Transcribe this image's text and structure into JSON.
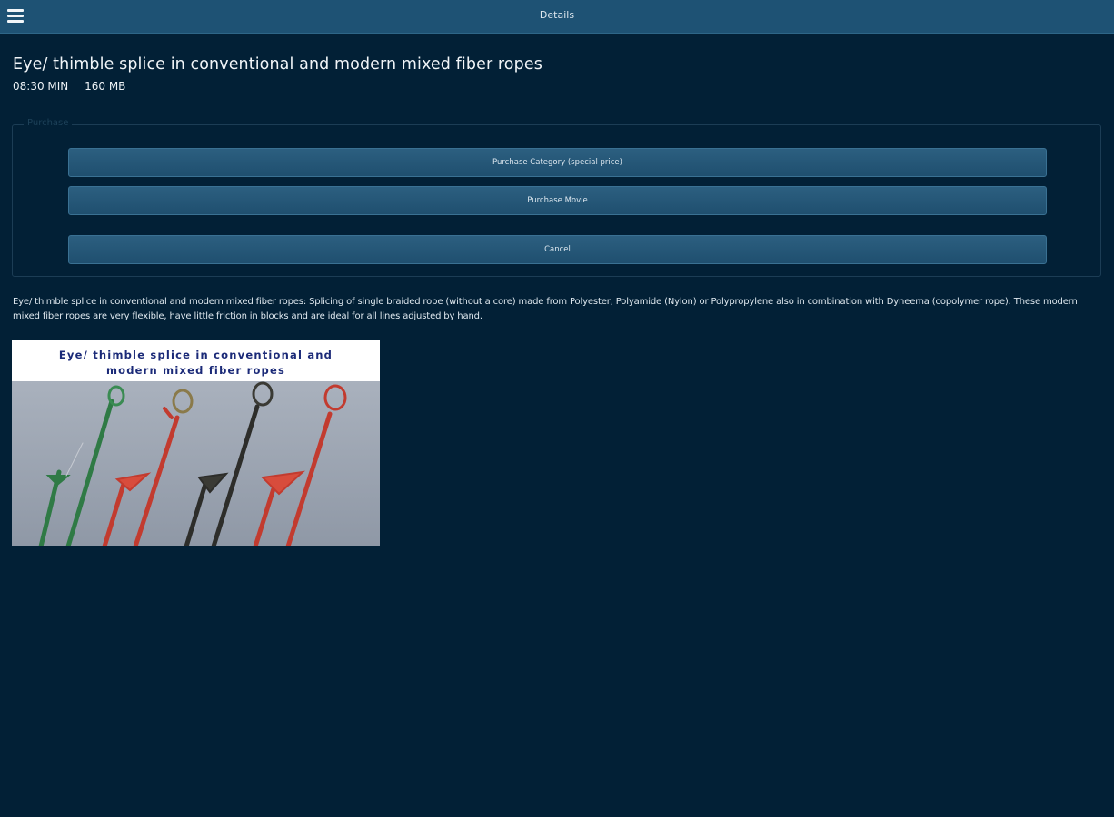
{
  "header": {
    "title": "Details"
  },
  "movie": {
    "title": "Eye/ thimble splice in conventional and modern mixed fiber ropes",
    "duration": "08:30 MIN",
    "size": "160 MB"
  },
  "purchase": {
    "legend": "Purchase",
    "buttons": {
      "category": "Purchase Category (special price)",
      "movie": "Purchase Movie",
      "cancel": "Cancel"
    }
  },
  "description": "Eye/ thimble splice in conventional and modern mixed fiber ropes: Splicing of single braided rope (without a core) made from Polyester, Polyamide (Nylon) or Polypropylene also in combination with Dyneema (copolymer rope). These modern mixed fiber ropes are very flexible, have little friction in blocks and are ideal for all lines adjusted by hand.",
  "thumbnail": {
    "line1": "Eye/ thimble splice in conventional and",
    "line2": "modern mixed fiber ropes"
  },
  "colors": {
    "background": "#022036",
    "topbar": "#1e5274",
    "button": "#245775"
  }
}
